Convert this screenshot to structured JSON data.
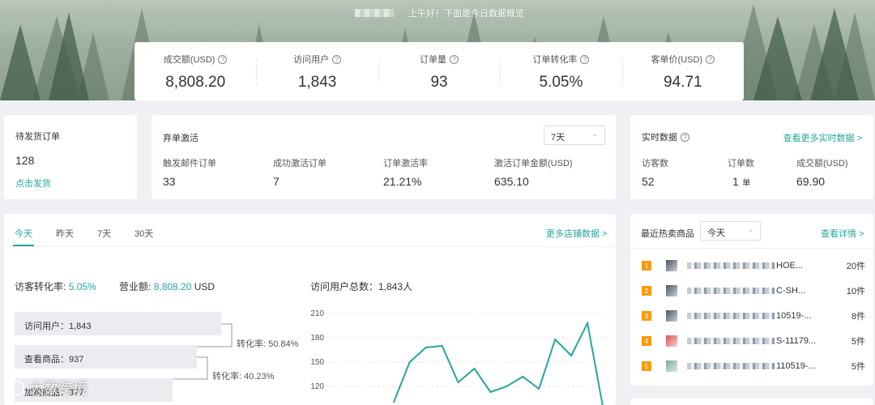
{
  "greeting": "上午好！下面是今日数据概览",
  "kpis": [
    {
      "label": "成交额(USD)",
      "value": "8,808.20"
    },
    {
      "label": "访问用户",
      "value": "1,843"
    },
    {
      "label": "订单量",
      "value": "93"
    },
    {
      "label": "订单转化率",
      "value": "5.05%"
    },
    {
      "label": "客单价(USD)",
      "value": "94.71"
    }
  ],
  "pending": {
    "title": "待发货订单",
    "count": "128",
    "link": "点击发货"
  },
  "abandon": {
    "title": "弃单激活",
    "range": "7天",
    "metrics": [
      {
        "label": "触发邮件订单",
        "value": "33"
      },
      {
        "label": "成功激活订单",
        "value": "7"
      },
      {
        "label": "订单激活率",
        "value": "21.21%"
      },
      {
        "label": "激活订单金额(USD)",
        "value": "635.10"
      }
    ]
  },
  "realtime": {
    "title": "实时数据",
    "link": "查看更多实时数据 >",
    "metrics": [
      {
        "label": "访客数",
        "value": "52",
        "unit": ""
      },
      {
        "label": "订单数",
        "value": "1",
        "unit": "单"
      },
      {
        "label": "成交额(USD)",
        "value": "69.90",
        "unit": ""
      }
    ]
  },
  "tabs": [
    "今天",
    "昨天",
    "7天",
    "30天"
  ],
  "more_store": "更多店铺数据 >",
  "summary": {
    "conv_label": "访客转化率:",
    "conv_value": "5.05%",
    "rev_label": "营业额:",
    "rev_value": "8,808.20",
    "rev_unit": "USD",
    "visitors_total": "访问用户总数：1,843人"
  },
  "funnel": [
    {
      "label": "访问用户：1,843",
      "conv": "转化率:  50.84%"
    },
    {
      "label": "查看商品：937",
      "conv": "转化率:  40.23%"
    },
    {
      "label": "加购商品：377",
      "conv": ""
    }
  ],
  "chart_data": {
    "type": "line",
    "y_ticks": [
      "210",
      "180",
      "150",
      "120"
    ],
    "ylim": [
      105,
      215
    ],
    "values": [
      null,
      null,
      null,
      null,
      100,
      150,
      168,
      170,
      125,
      142,
      113,
      120,
      132,
      117,
      178,
      158,
      198,
      90
    ],
    "color": "#26a69a",
    "grid": true
  },
  "hot": {
    "title": "最近热卖商品",
    "range": "今天",
    "link": "查看详情 >",
    "items": [
      {
        "rank": "1",
        "name_tail": "HOE...",
        "count": "20件",
        "rank_color": "#f39c12"
      },
      {
        "rank": "2",
        "name_tail": "C-SH...",
        "count": "10件",
        "rank_color": "#f39c12"
      },
      {
        "rank": "3",
        "name_tail": "10519-...",
        "count": "8件",
        "rank_color": "#f39c12"
      },
      {
        "rank": "4",
        "name_tail": "S-11179...",
        "count": "5件",
        "rank_color": "#f39c12"
      },
      {
        "rank": "5",
        "name_tail": "110519-...",
        "count": "5件",
        "rank_color": "#f39c12"
      }
    ]
  },
  "watermark": "大数跨境",
  "accent": "#26a69a"
}
